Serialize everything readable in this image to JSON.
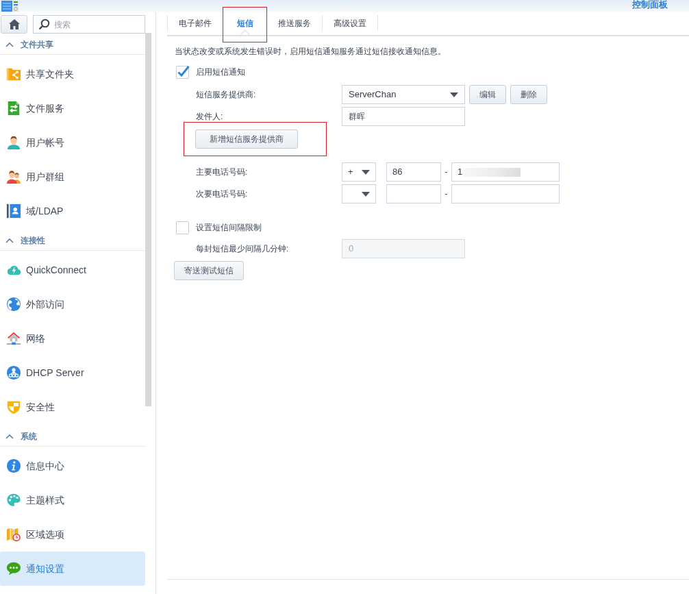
{
  "window": {
    "title": "控制面板"
  },
  "sidebar": {
    "search": {
      "placeholder": "搜索"
    },
    "sections": [
      {
        "title": "文件共享",
        "expanded": true,
        "items": [
          {
            "label": "共享文件夹",
            "selected": false
          },
          {
            "label": "文件服务",
            "selected": false
          },
          {
            "label": "用户帐号",
            "selected": false
          },
          {
            "label": "用户群组",
            "selected": false
          },
          {
            "label": "域/LDAP",
            "selected": false
          }
        ]
      },
      {
        "title": "连接性",
        "expanded": true,
        "items": [
          {
            "label": "QuickConnect",
            "selected": false
          },
          {
            "label": "外部访问",
            "selected": false
          },
          {
            "label": "网络",
            "selected": false
          },
          {
            "label": "DHCP Server",
            "selected": false
          },
          {
            "label": "安全性",
            "selected": false
          }
        ]
      },
      {
        "title": "系统",
        "expanded": true,
        "items": [
          {
            "label": "信息中心",
            "selected": false
          },
          {
            "label": "主题样式",
            "selected": false
          },
          {
            "label": "区域选项",
            "selected": false
          },
          {
            "label": "通知设置",
            "selected": true
          }
        ]
      }
    ]
  },
  "tabs": [
    {
      "label": "电子邮件",
      "selected": false,
      "highlighted": false
    },
    {
      "label": "短信",
      "selected": true,
      "highlighted": true
    },
    {
      "label": "推送服务",
      "selected": false,
      "highlighted": false
    },
    {
      "label": "高级设置",
      "selected": false,
      "highlighted": false
    }
  ],
  "sms": {
    "description": "当状态改变或系统发生错误时，启用短信通知服务通过短信接收通知信息。",
    "enable": {
      "label": "启用短信通知",
      "checked": true
    },
    "provider": {
      "label": "短信服务提供商:",
      "value": "ServerChan",
      "buttons": [
        "编辑",
        "删除"
      ]
    },
    "sender": {
      "label": "发件人:",
      "value": "群晖"
    },
    "add_provider_button": {
      "label": "新增短信服务提供商",
      "highlighted": true
    },
    "phones": [
      {
        "label": "主要电话号码:",
        "prefix": "+",
        "country_code": "86",
        "separator": "-",
        "number": "1",
        "redacted": true
      },
      {
        "label": "次要电话号码:",
        "separator": "-",
        "redacted": false
      }
    ],
    "interval_limit": {
      "label": "设置短信间隔限制",
      "checked": false
    },
    "min_interval": {
      "label": "每封短信最少间隔几分钟:",
      "value": "0",
      "disabled": true
    },
    "test_button": "寄送测试短信"
  }
}
